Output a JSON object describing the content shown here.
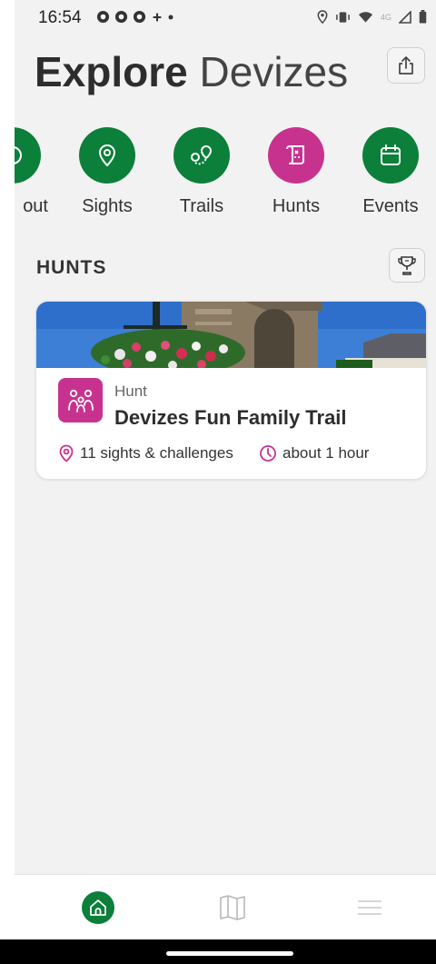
{
  "status_bar": {
    "time": "16:54",
    "left_icons": [
      "notification-icon",
      "notification-icon",
      "notification-icon",
      "plus-dot-icon"
    ],
    "right_icons": [
      "location-icon",
      "vibrate-icon",
      "wifi-icon",
      "signal-4g-icon",
      "battery-icon"
    ],
    "network": "4G"
  },
  "header": {
    "title_bold": "Explore",
    "title_light": "Devizes"
  },
  "categories": [
    {
      "label": "out",
      "icon": "info-icon",
      "color": "#0c7f3a"
    },
    {
      "label": "Sights",
      "icon": "location-pin-icon",
      "color": "#0c7f3a"
    },
    {
      "label": "Trails",
      "icon": "trail-route-icon",
      "color": "#0c7f3a"
    },
    {
      "label": "Hunts",
      "icon": "treasure-map-icon",
      "color": "#c8328f"
    },
    {
      "label": "Events",
      "icon": "calendar-icon",
      "color": "#0c7f3a"
    }
  ],
  "section": {
    "title": "HUNTS"
  },
  "hunt_card": {
    "type": "Hunt",
    "title": "Devizes Fun Family Trail",
    "sights": "11 sights & challenges",
    "duration": "about 1 hour",
    "accent": "#c8328f"
  },
  "bottom_nav": {
    "items": [
      "home-icon",
      "map-icon",
      "menu-icon"
    ],
    "active": "home-icon"
  },
  "colors": {
    "green": "#0c7f3a",
    "magenta": "#c8328f",
    "background": "#f2f2f2"
  }
}
